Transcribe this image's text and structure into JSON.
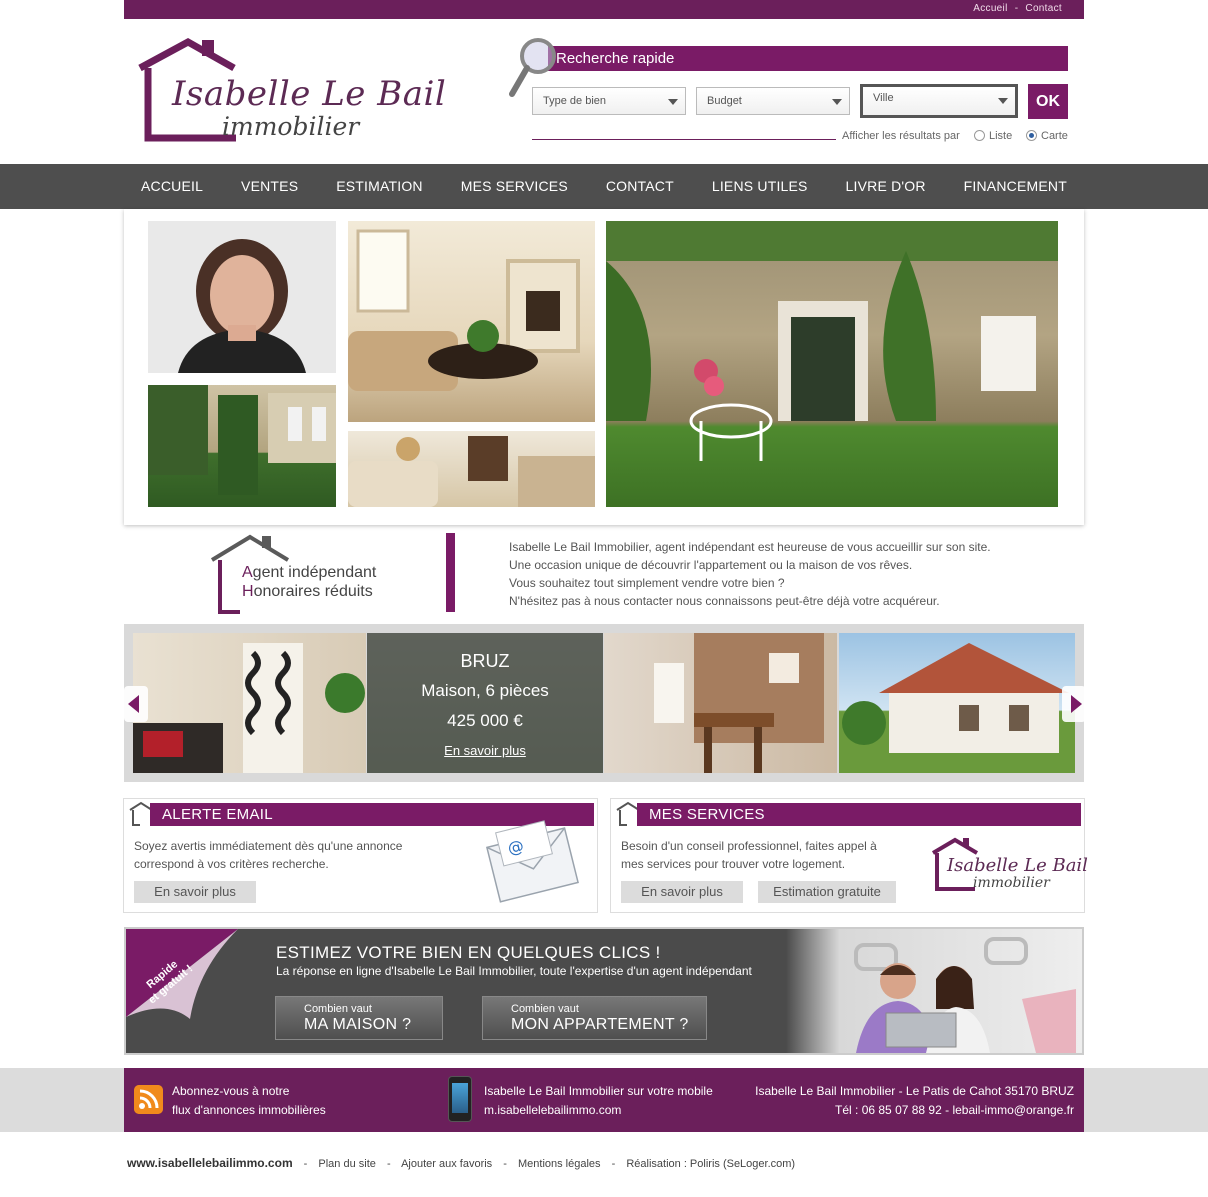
{
  "top_links": {
    "home": "Accueil",
    "separator": "-",
    "contact": "Contact"
  },
  "logo": {
    "name": "Isabelle Le Bail",
    "sub": "immobilier"
  },
  "search": {
    "title": "Recherche rapide",
    "type_select": "Type de bien",
    "budget_select": "Budget",
    "city_select": "Ville",
    "ok_label": "OK",
    "results_label": "Afficher les résultats par",
    "option_list": "Liste",
    "option_map": "Carte"
  },
  "nav": {
    "items": [
      "Accueil",
      "Ventes",
      "Estimation",
      "Mes services",
      "Contact",
      "Liens utiles",
      "Livre d'or",
      "Financement"
    ]
  },
  "intro": {
    "badge_line1_initial": "A",
    "badge_line1_rest": "gent indépendant",
    "badge_line2_initial": "H",
    "badge_line2_rest": "onoraires réduits",
    "text": [
      "Isabelle Le Bail Immobilier, agent indépendant est heureuse de vous accueillir sur son site.",
      "Une occasion unique de découvrir l'appartement ou la maison de vos rêves.",
      "Vous souhaitez tout simplement vendre votre bien ?",
      "N'hésitez pas à nous contacter nous connaissons peut-être déjà votre acquéreur."
    ]
  },
  "featured": {
    "city": "BRUZ",
    "type": "Maison, 6 pièces",
    "price": "425 000 €",
    "more": "En savoir plus"
  },
  "alert_box": {
    "title": "ALERTE EMAIL",
    "text_line1": "Soyez avertis immédiatement dès qu'une annonce",
    "text_line2": "correspond à vos critères recherche.",
    "button": "En savoir plus"
  },
  "services_box": {
    "title": "MES SERVICES",
    "text_line1": "Besoin d'un conseil professionnel, faites appel à",
    "text_line2": "mes services pour trouver votre logement.",
    "button_more": "En savoir plus",
    "button_estimate": "Estimation gratuite"
  },
  "estimate_banner": {
    "corner_line1": "Rapide",
    "corner_line2": "et gratuit !",
    "title": "ESTIMEZ VOTRE BIEN EN QUELQUES CLICS !",
    "subtitle": "La réponse en ligne d'Isabelle Le Bail Immobilier, toute l'expertise d'un agent indépendant",
    "house_small": "Combien vaut",
    "house_big": "MA MAISON ?",
    "apt_small": "Combien vaut",
    "apt_big": "MON APPARTEMENT ?"
  },
  "footer": {
    "rss_line1": "Abonnez-vous à notre",
    "rss_line2": "flux d'annonces immobilières",
    "mobile_line1": "Isabelle Le Bail Immobilier sur votre mobile",
    "mobile_line2": "m.isabellelebailimmo.com",
    "address": "Isabelle Le Bail Immobilier - Le Patis de Cahot 35170 BRUZ",
    "contact": "Tél : 06 85 07 88 92 - lebail-immo@orange.fr"
  },
  "bottom_links": {
    "site": "www.isabellelebailimmo.com",
    "separator": "-",
    "sitemap": "Plan du site",
    "favorites": "Ajouter aux favoris",
    "legal": "Mentions légales",
    "credit": "Réalisation : Poliris (SeLoger.com)"
  },
  "colors": {
    "brand": "#7a1b66",
    "nav": "#4e4e4e"
  }
}
